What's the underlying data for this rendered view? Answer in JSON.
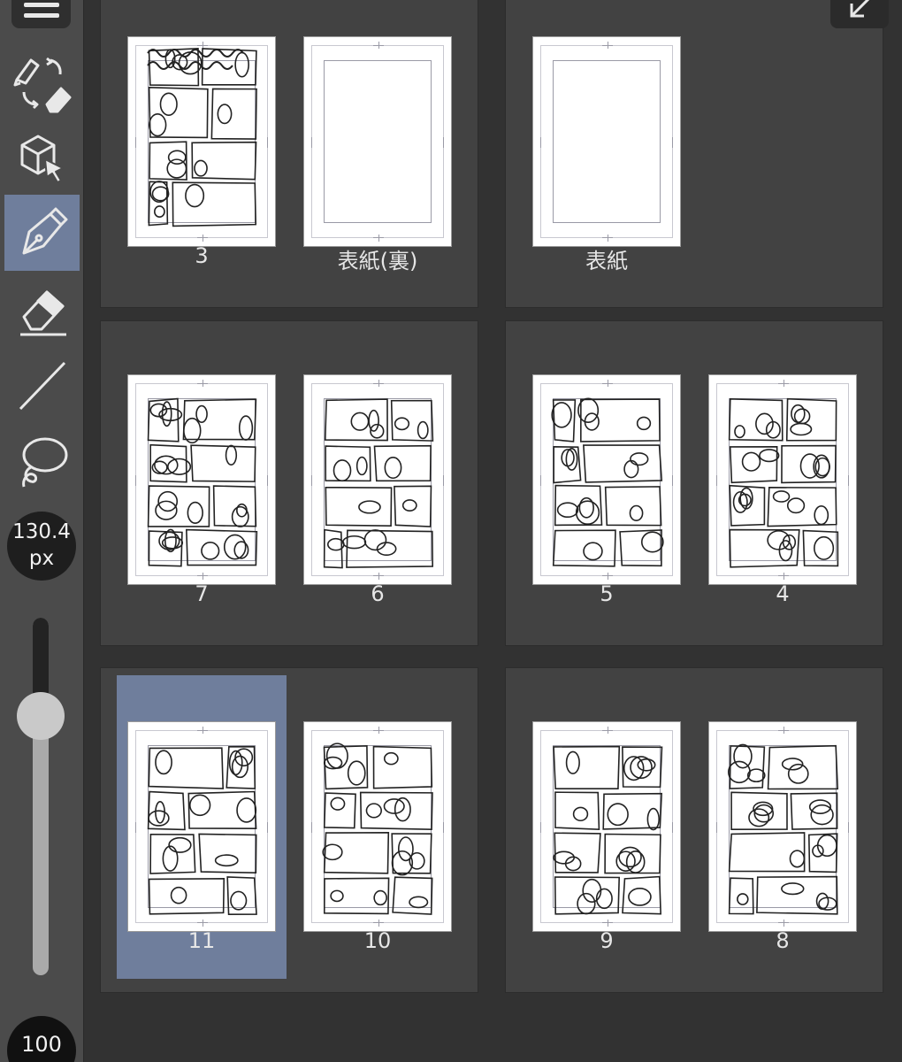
{
  "toolbar": {
    "menu_icon": "hamburger-menu-icon",
    "tools": [
      {
        "name": "pen-eraser-switch-icon",
        "active": false
      },
      {
        "name": "3d-object-select-icon",
        "active": false
      },
      {
        "name": "pen-icon",
        "active": true
      },
      {
        "name": "eraser-icon",
        "active": false
      },
      {
        "name": "line-icon",
        "active": false
      },
      {
        "name": "lasso-icon",
        "active": false
      }
    ],
    "brush_size_value": "130.4",
    "brush_size_unit": "px",
    "slider_level": 0.28,
    "opacity_value": "100"
  },
  "page_manager": {
    "corner_icon": "collapse-arrow-icon",
    "spreads": [
      {
        "pages": [
          {
            "label": "3",
            "sketch": "cover"
          },
          {
            "label": "表紙(裏)",
            "sketch": "blank"
          }
        ]
      },
      {
        "pages": [
          {
            "label": "表紙",
            "sketch": "blank"
          }
        ]
      },
      {
        "pages": [
          {
            "label": "7",
            "sketch": "panels"
          },
          {
            "label": "6",
            "sketch": "panels"
          }
        ]
      },
      {
        "pages": [
          {
            "label": "5",
            "sketch": "panels"
          },
          {
            "label": "4",
            "sketch": "panels"
          }
        ]
      },
      {
        "pages": [
          {
            "label": "11",
            "sketch": "panels",
            "selected": true
          },
          {
            "label": "10",
            "sketch": "panels"
          }
        ]
      },
      {
        "pages": [
          {
            "label": "9",
            "sketch": "panels"
          },
          {
            "label": "8",
            "sketch": "panels"
          }
        ]
      }
    ]
  }
}
